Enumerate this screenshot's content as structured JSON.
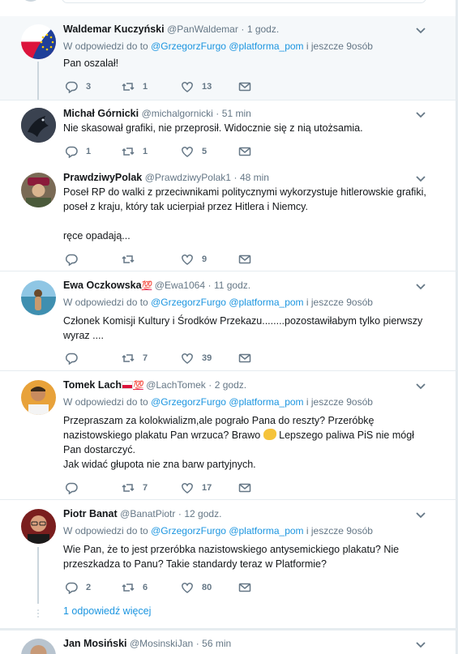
{
  "colors": {
    "link": "#1b95e0",
    "muted": "#657786",
    "highlight_bg": "#f5f8fa"
  },
  "tweets": [
    {
      "name": "Waldemar Kuczyński",
      "handle": "@PanWaldemar",
      "time": "1 godz.",
      "reply_prefix": "W odpowiedzi do to",
      "reply_link1": "@GrzegorzFurgo",
      "reply_link2": "@platforma_pom",
      "reply_suffix": "i jeszcze 9osób",
      "text": "Pan oszalał!",
      "replies": "3",
      "retweets": "1",
      "likes": "13",
      "avatar_icon": "eu-flag-avatar"
    },
    {
      "name": "Michał Górnicki",
      "handle": "@michalgornicki",
      "time": "51 min",
      "text": "Nie skasował grafiki, nie przeprosił. Widocznie się z nią utożsamia.",
      "replies": "1",
      "retweets": "1",
      "likes": "5"
    },
    {
      "name": "PrawdziwyPolak",
      "handle": "@PrawdziwyPolak1",
      "time": "48 min",
      "text_lines": [
        "Poseł RP do walki z przeciwnikami politycznymi wykorzystuje hitlerowskie grafiki,",
        "poseł z kraju, który tak ucierpiał przez Hitlera i Niemcy.",
        "",
        "ręce opadają..."
      ],
      "replies": "",
      "retweets": "",
      "likes": "9"
    },
    {
      "name": "Ewa Oczkowska",
      "name_emoji": "💯",
      "handle": "@Ewa1064",
      "time": "11 godz.",
      "reply_prefix": "W odpowiedzi do to",
      "reply_link1": "@GrzegorzFurgo",
      "reply_link2": "@platforma_pom",
      "reply_suffix": "i jeszcze 9osób",
      "text_lines": [
        "Członek Komisji Kultury i Środków Przekazu........pozostawiłabym tylko pierwszy",
        "wyraz ...."
      ],
      "replies": "",
      "retweets": "7",
      "likes": "39"
    },
    {
      "name": "Tomek Lach",
      "name_emoji": "💯",
      "handle": "@LachTomek",
      "time": "2 godz.",
      "reply_prefix": "W odpowiedzi do to",
      "reply_link1": "@GrzegorzFurgo",
      "reply_link2": "@platforma_pom",
      "reply_suffix": "i jeszcze 9osób",
      "text_lines": [
        "Przepraszam za kolokwializm,ale pograło Pana do reszty? Przeróbkę",
        "nazistowskiego plakatu Pan wrzuca? Brawo",
        "Lepszego paliwa PiS nie mógł",
        "Pan dostarczyć.",
        "Jak widać głupota nie zna barw partyjnych."
      ],
      "replies": "",
      "retweets": "7",
      "likes": "17"
    },
    {
      "name": "Piotr Banat",
      "handle": "@BanatPiotr",
      "time": "12 godz.",
      "reply_prefix": "W odpowiedzi do to",
      "reply_link1": "@GrzegorzFurgo",
      "reply_link2": "@platforma_pom",
      "reply_suffix": "i jeszcze 9osób",
      "text_lines": [
        "Wie Pan, że to jest przeróbka nazistowskiego antysemickiego plakatu? Nie",
        "przeszkadza to Panu? Takie standardy teraz w Platformie?"
      ],
      "replies": "2",
      "retweets": "6",
      "likes": "80",
      "more_replies": "1 odpowiedź więcej"
    },
    {
      "name": "Jan Mosiński",
      "handle": "@MosinskiJan",
      "time": "56 min"
    }
  ]
}
